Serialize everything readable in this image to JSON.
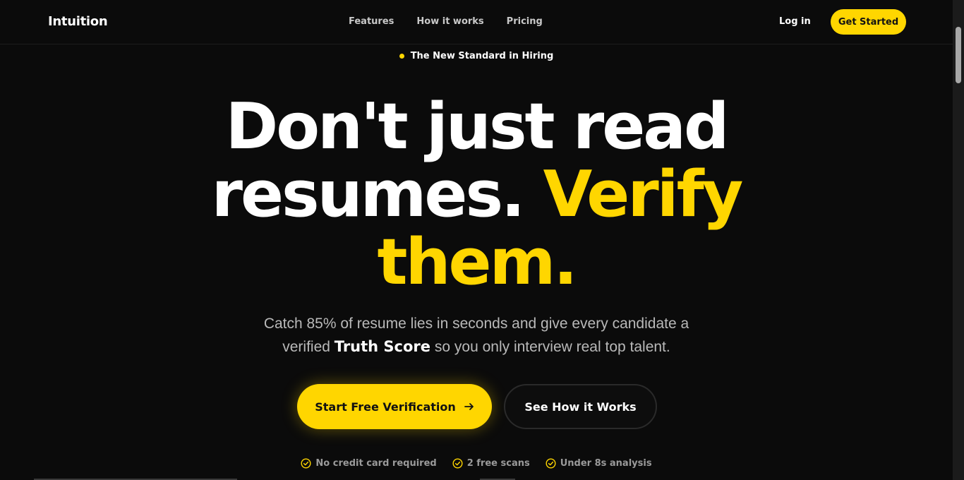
{
  "header": {
    "logo": "Intuition",
    "nav": [
      "Features",
      "How it works",
      "Pricing"
    ],
    "login": "Log in",
    "cta": "Get Started"
  },
  "hero": {
    "badge": "The New Standard in Hiring",
    "headline_line1": "Don't just read",
    "headline_line2_white": "resumes.",
    "headline_line2_accent": "Verify",
    "headline_line3_accent": "them.",
    "sub_part1": "Catch 85% of resume lies in seconds and give every candidate a",
    "sub_part2_pre": "verified",
    "sub_part2_bold": "Truth Score",
    "sub_part2_post": "so you only interview real top talent.",
    "primary_cta": "Start Free Verification",
    "secondary_cta": "See How it Works",
    "features": [
      "No credit card required",
      "2 free scans",
      "Under 8s analysis"
    ]
  },
  "colors": {
    "accent": "#ffd600",
    "background": "#0b0b0b"
  },
  "icons": {
    "badge": "dot-icon",
    "primary_cta": "arrow-right-icon",
    "features": "check-circle-icon"
  }
}
